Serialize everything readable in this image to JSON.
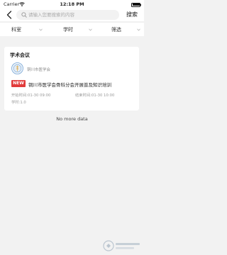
{
  "status_bar": {
    "carrier": "Carrier",
    "time": "12:18 PM"
  },
  "header": {
    "search_placeholder": "请输入您要搜索的内容",
    "search_label": "搜索"
  },
  "filters": [
    {
      "label": "科室"
    },
    {
      "label": "学时"
    },
    {
      "label": "筛选"
    }
  ],
  "card": {
    "category": "学术会议",
    "org_name": "铜川市医学会",
    "badge": "NEW",
    "title": "铜川市医学会骨科分会开展普及知识培训",
    "start_time": "开始时间:01-30 09:00",
    "end_time": "结束时间:01-30 10:00",
    "credit_hours": "学时:1.0"
  },
  "list_end_text": "No more data",
  "colors": {
    "badge": "#e13b3b",
    "background": "#f2f2f2",
    "card": "#ffffff"
  }
}
